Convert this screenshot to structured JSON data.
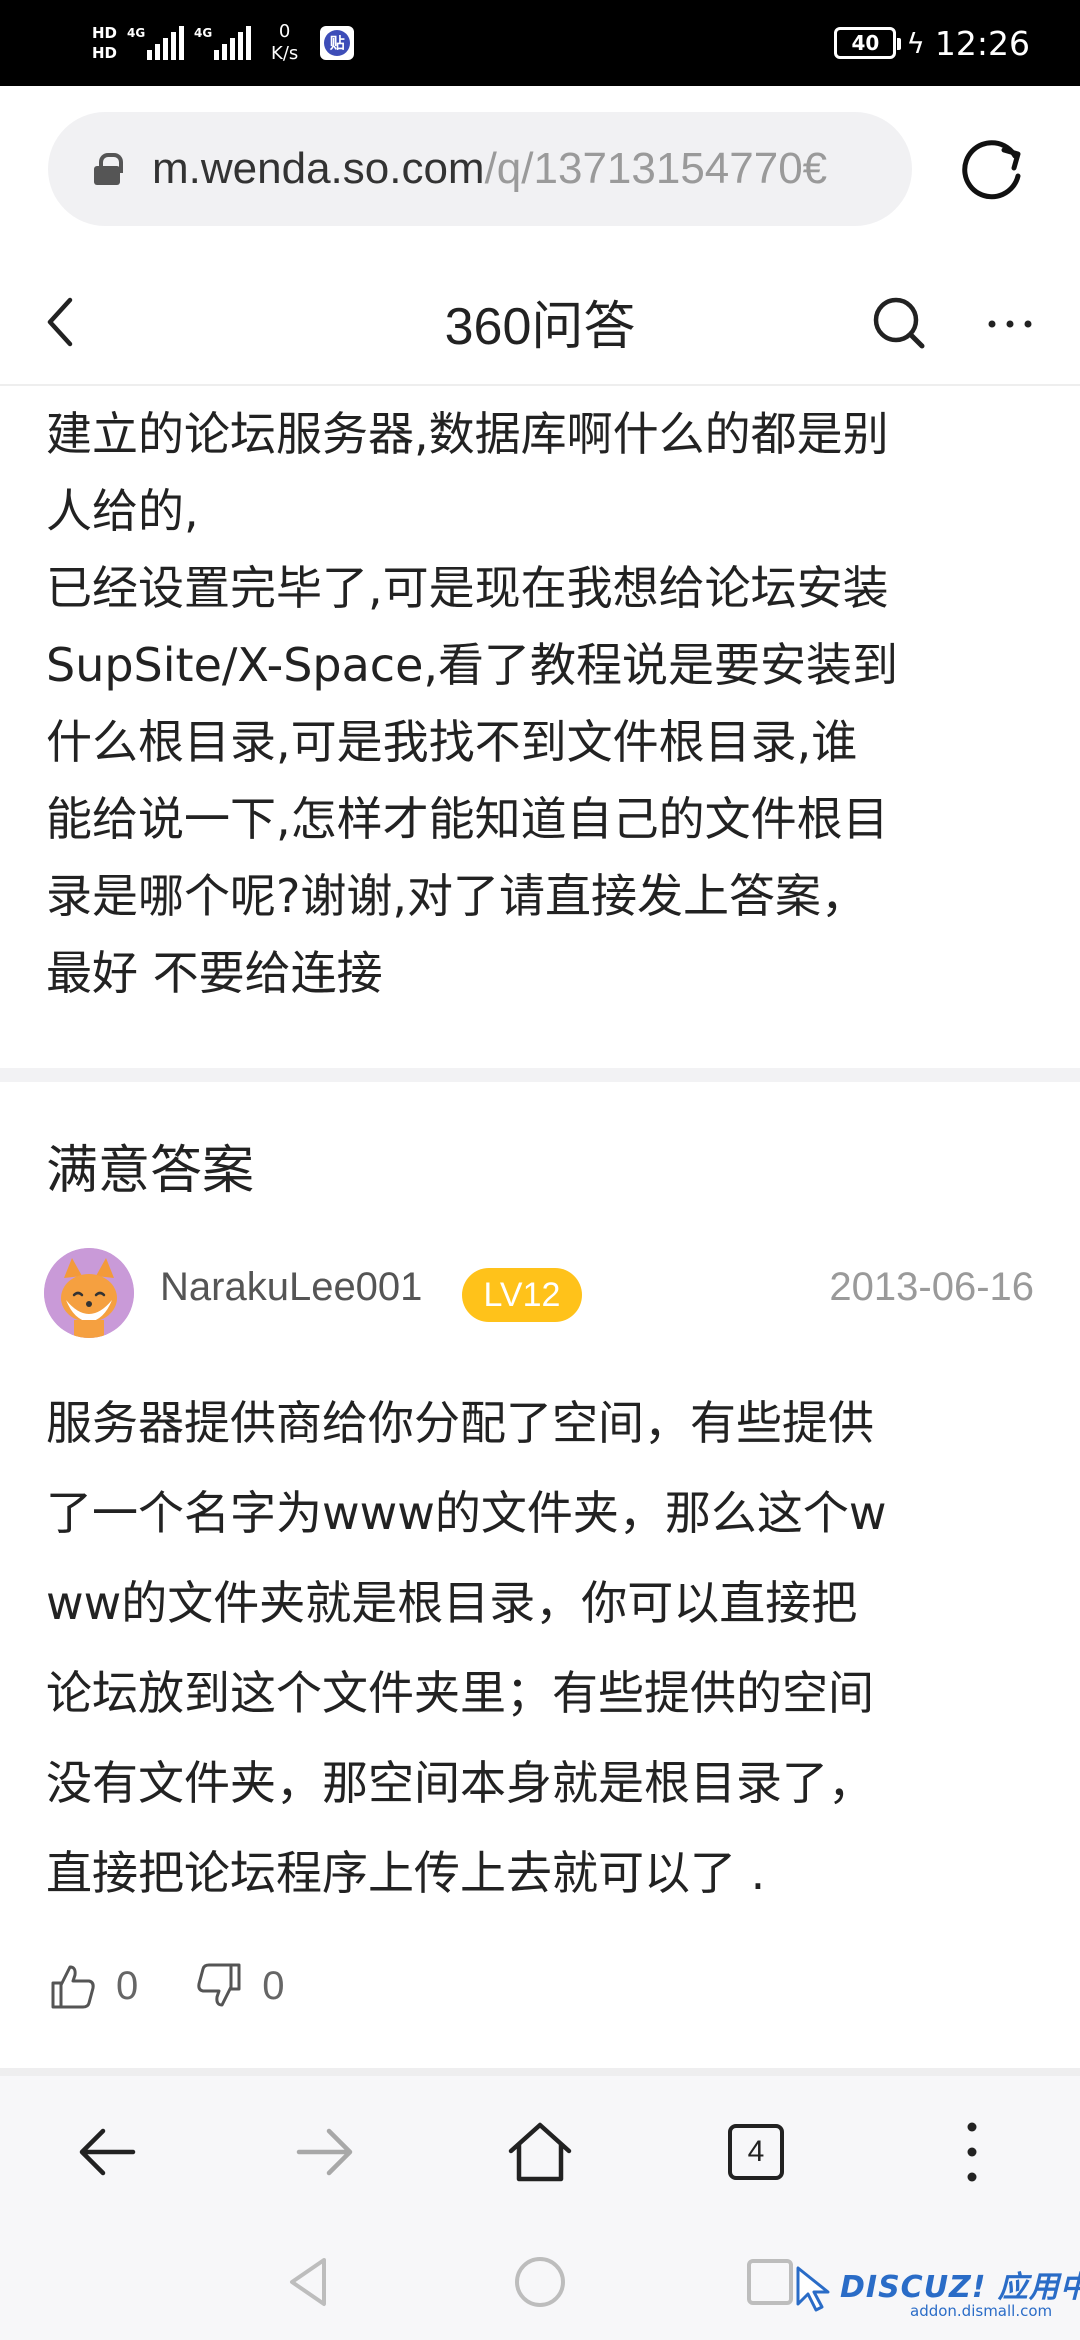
{
  "status_bar": {
    "hd_top": "HD",
    "hd_bottom": "HD",
    "net_gen_1": "4G",
    "net_gen_2": "4G",
    "speed_value": "0",
    "speed_unit": "K/s",
    "app_icon": "贴",
    "battery": "40",
    "time": "12:26"
  },
  "browser": {
    "url_host": "m.wenda.so.com",
    "url_path": "/q/13713154770€"
  },
  "header": {
    "title": "360问答"
  },
  "question": {
    "lines": [
      "建立的论坛服务器,数据库啊什么的都是别",
      "人给的,",
      "已经设置完毕了,可是现在我想给论坛安装",
      "SupSite/X-Space,看了教程说是要安装到",
      "什么根目录,可是我找不到文件根目录,谁",
      "能给说一下,怎样才能知道自己的文件根目",
      "录是哪个呢?谢谢,对了请直接发上答案，",
      "最好 不要给连接"
    ]
  },
  "answer": {
    "heading": "满意答案",
    "username": "NarakuLee001",
    "level": "LV12",
    "date": "2013-06-16",
    "lines": [
      "服务器提供商给你分配了空间，有些提供",
      "了一个名字为www的文件夹，那么这个w",
      "ww的文件夹就是根目录，你可以直接把",
      "论坛放到这个文件夹里；有些提供的空间",
      "没有文件夹，那空间本身就是根目录了，",
      "直接把论坛程序上传上去就可以了 ."
    ],
    "likes": "0",
    "dislikes": "0"
  },
  "toolbar": {
    "tab_count": "4"
  },
  "watermark": {
    "brand": "DISCUZ! 应用中心",
    "site": "addon.dismall.com"
  }
}
